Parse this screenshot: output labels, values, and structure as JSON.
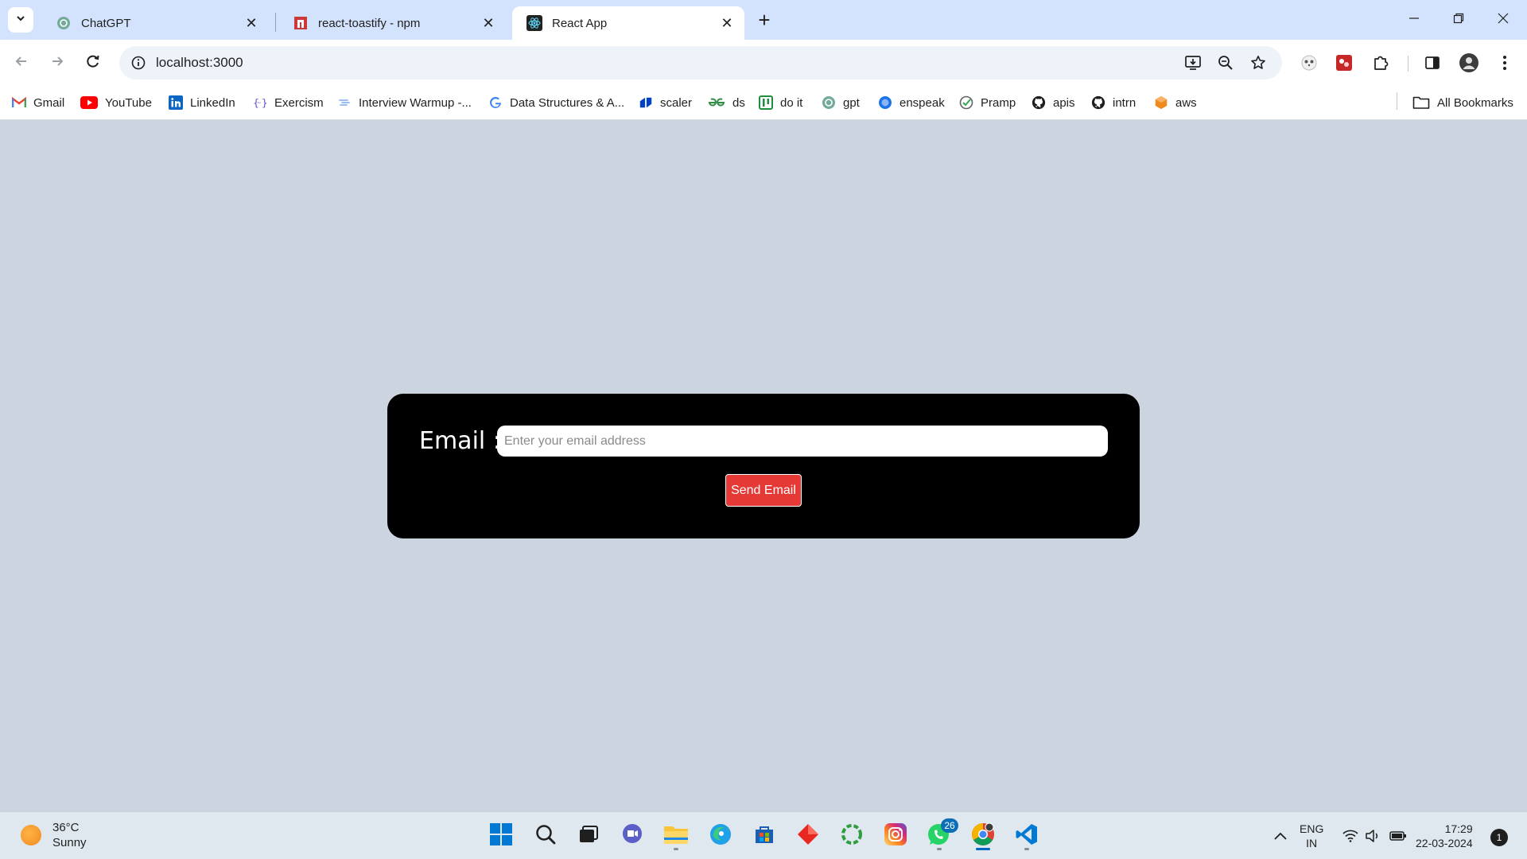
{
  "browser": {
    "tabs": [
      {
        "title": "ChatGPT",
        "icon": "chatgpt-icon",
        "active": false
      },
      {
        "title": "react-toastify - npm",
        "icon": "npm-icon",
        "active": false
      },
      {
        "title": "React App",
        "icon": "react-icon",
        "active": true
      }
    ],
    "address": "localhost:3000",
    "bookmarks": [
      {
        "label": "Gmail",
        "icon": "gmail-icon"
      },
      {
        "label": "YouTube",
        "icon": "youtube-icon"
      },
      {
        "label": "LinkedIn",
        "icon": "linkedin-icon"
      },
      {
        "label": "Exercism",
        "icon": "exercism-icon"
      },
      {
        "label": "Interview Warmup -...",
        "icon": "interview-warmup-icon"
      },
      {
        "label": "Data Structures & A...",
        "icon": "google-icon"
      },
      {
        "label": "scaler",
        "icon": "scaler-icon"
      },
      {
        "label": "ds",
        "icon": "gfg-icon"
      },
      {
        "label": "do it",
        "icon": "doit-icon"
      },
      {
        "label": "gpt",
        "icon": "chatgpt-icon"
      },
      {
        "label": "enspeak",
        "icon": "enspeak-icon"
      },
      {
        "label": "Pramp",
        "icon": "pramp-icon"
      },
      {
        "label": "apis",
        "icon": "github-icon"
      },
      {
        "label": "intrn",
        "icon": "github-icon"
      },
      {
        "label": "aws",
        "icon": "aws-icon"
      }
    ],
    "all_bookmarks": "All Bookmarks"
  },
  "app": {
    "email_label": "Email :",
    "email_placeholder": "Enter your email address",
    "email_value": "",
    "send_button": "Send Email",
    "colors": {
      "card": "#000000",
      "button": "#e53935",
      "page_bg": "#ccd5df"
    }
  },
  "taskbar": {
    "weather": {
      "temp": "36°C",
      "condition": "Sunny"
    },
    "whatsapp_badge": "26",
    "language": {
      "line1": "ENG",
      "line2": "IN"
    },
    "time": "17:29",
    "date": "22-03-2024",
    "notifications": "1"
  }
}
